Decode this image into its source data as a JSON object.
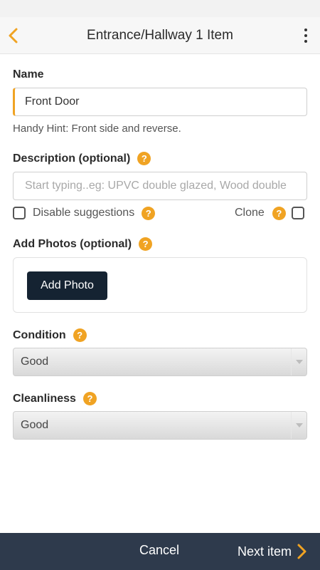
{
  "header": {
    "title": "Entrance/Hallway 1 Item",
    "back_icon": "chevron-left-icon",
    "menu_icon": "more-vertical-icon"
  },
  "name": {
    "label": "Name",
    "value": "Front Door",
    "hint": "Handy Hint: Front side and reverse."
  },
  "description": {
    "label": "Description (optional)",
    "placeholder": "Start typing..eg: UPVC double glazed, Wood double"
  },
  "suggestions": {
    "disable_label": "Disable suggestions",
    "clone_label": "Clone"
  },
  "photos": {
    "label": "Add Photos (optional)",
    "button_label": "Add Photo"
  },
  "condition": {
    "label": "Condition",
    "selected": "Good"
  },
  "cleanliness": {
    "label": "Cleanliness",
    "selected": "Good"
  },
  "help_glyph": "?",
  "footer": {
    "cancel_label": "Cancel",
    "next_label": "Next item"
  },
  "colors": {
    "accent": "#f0a323",
    "footer_bg": "#2e3a4c",
    "button_dark": "#152332"
  }
}
